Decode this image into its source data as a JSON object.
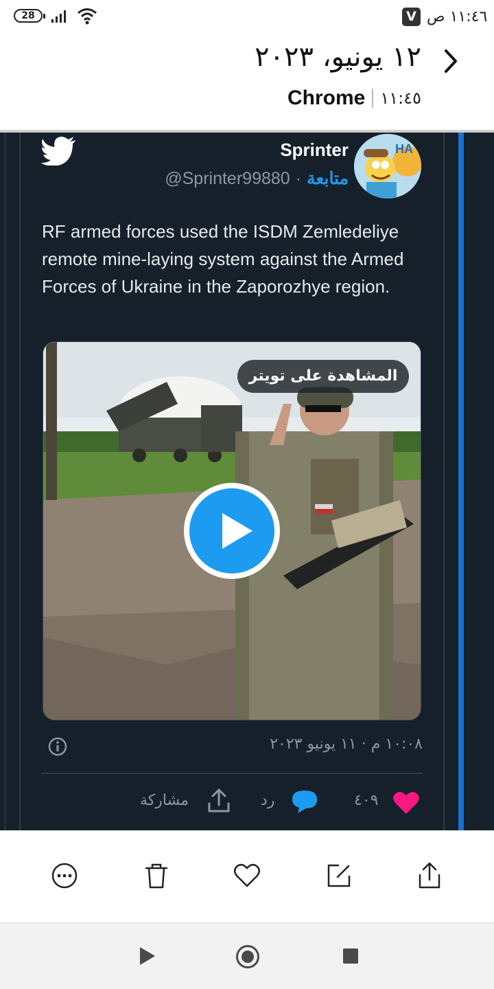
{
  "status_bar": {
    "battery": "28",
    "badge": "V",
    "time": "١١:٤٦ ص"
  },
  "header": {
    "title": "١٢ يونيو، ٢٠٢٣",
    "app_name": "Chrome",
    "time": "١١:٤٥"
  },
  "tweet": {
    "author_name": "Sprinter",
    "handle": "@Sprinter99880",
    "dot": "·",
    "follow_label": "متابعة",
    "text": "RF armed forces used the ISDM Zemledeliye remote mine-laying system against the Armed Forces of Ukraine in the Zaporozhye region.",
    "video_overlay_label": "المشاهدة على تويتر",
    "timestamp": "١٠:٠٨ م · ١١ يونيو ٢٠٢٣",
    "likes": "٤٠٩",
    "reply_label": "رد",
    "share_label": "مشاركة"
  },
  "colors": {
    "tweet_bg": "#15202b",
    "accent_blue": "#1d9bf0",
    "like_pink": "#f91880",
    "muted_text": "#8b98a5"
  },
  "icons": [
    "twitter-bird-icon",
    "info-icon",
    "heart-icon",
    "reply-icon",
    "share-icon",
    "more-icon",
    "trash-icon",
    "favorite-icon",
    "edit-icon",
    "export-icon"
  ]
}
